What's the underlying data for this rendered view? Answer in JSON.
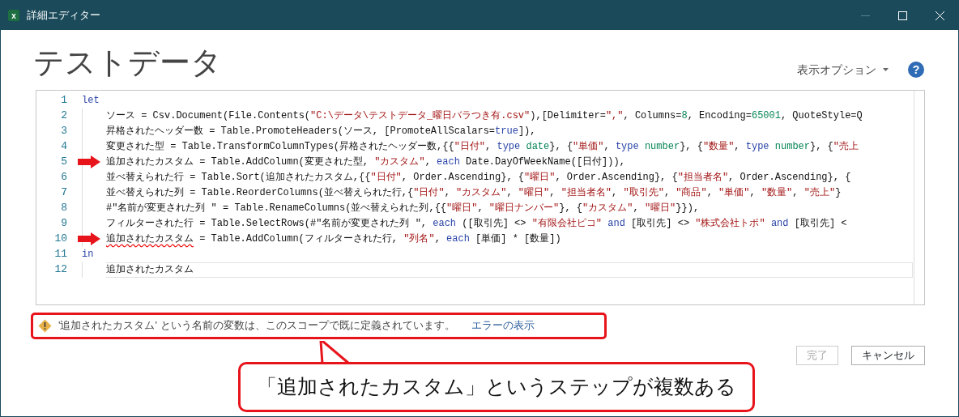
{
  "window": {
    "title": "詳細エディター",
    "app_icon": "x"
  },
  "help_icon": "?",
  "query_title": "テストデータ",
  "display_options": "表示オプション",
  "code": {
    "lines": [
      {
        "number": "1",
        "arrow": false,
        "current": false,
        "tokens": [
          {
            "kind": "keyword",
            "text": "let"
          }
        ],
        "children": [
          {
            "number": "2",
            "arrow": false,
            "current": false,
            "tokens": [
              {
                "kind": "text",
                "text": "ソース = Csv.Document(File.Contents("
              },
              {
                "kind": "string",
                "text": "\"C:\\データ\\テストデータ_曜日バラつき有.csv\""
              },
              {
                "kind": "text",
                "text": "),[Delimiter="
              },
              {
                "kind": "string",
                "text": "\",\""
              },
              {
                "kind": "text",
                "text": ", Columns="
              },
              {
                "kind": "number",
                "text": "8"
              },
              {
                "kind": "text",
                "text": ", Encoding="
              },
              {
                "kind": "number",
                "text": "65001"
              },
              {
                "kind": "text",
                "text": ", QuoteStyle=Q"
              }
            ]
          },
          {
            "number": "3",
            "arrow": false,
            "current": false,
            "tokens": [
              {
                "kind": "text",
                "text": "昇格されたヘッダー数 = Table.PromoteHeaders(ソース, [PromoteAllScalars="
              },
              {
                "kind": "keyword",
                "text": "true"
              },
              {
                "kind": "text",
                "text": "]),"
              }
            ]
          },
          {
            "number": "4",
            "arrow": false,
            "current": false,
            "tokens": [
              {
                "kind": "text",
                "text": "変更された型 = Table.TransformColumnTypes(昇格されたヘッダー数,{{"
              },
              {
                "kind": "string",
                "text": "\"日付\""
              },
              {
                "kind": "text",
                "text": ", "
              },
              {
                "kind": "keyword",
                "text": "type"
              },
              {
                "kind": "number",
                "text": " date"
              },
              {
                "kind": "text",
                "text": "}, {"
              },
              {
                "kind": "string",
                "text": "\"単価\""
              },
              {
                "kind": "text",
                "text": ", "
              },
              {
                "kind": "keyword",
                "text": "type"
              },
              {
                "kind": "number",
                "text": " number"
              },
              {
                "kind": "text",
                "text": "}, {"
              },
              {
                "kind": "string",
                "text": "\"数量\""
              },
              {
                "kind": "text",
                "text": ", "
              },
              {
                "kind": "keyword",
                "text": "type"
              },
              {
                "kind": "number",
                "text": " number"
              },
              {
                "kind": "text",
                "text": "}, {"
              },
              {
                "kind": "string",
                "text": "\"売上"
              }
            ]
          },
          {
            "number": "5",
            "arrow": true,
            "current": false,
            "tokens": [
              {
                "kind": "text",
                "text": "追加されたカスタム = Table.AddColumn(変更された型, "
              },
              {
                "kind": "string",
                "text": "\"カスタム\""
              },
              {
                "kind": "text",
                "text": ", "
              },
              {
                "kind": "keyword",
                "text": "each"
              },
              {
                "kind": "text",
                "text": " Date.DayOfWeekName([日付])),"
              }
            ]
          },
          {
            "number": "6",
            "arrow": false,
            "current": false,
            "tokens": [
              {
                "kind": "text",
                "text": "並べ替えられた行 = Table.Sort(追加されたカスタム,{{"
              },
              {
                "kind": "string",
                "text": "\"日付\""
              },
              {
                "kind": "text",
                "text": ", Order.Ascending}, {"
              },
              {
                "kind": "string",
                "text": "\"曜日\""
              },
              {
                "kind": "text",
                "text": ", Order.Ascending}, {"
              },
              {
                "kind": "string",
                "text": "\"担当者名\""
              },
              {
                "kind": "text",
                "text": ", Order.Ascending}, {"
              }
            ]
          },
          {
            "number": "7",
            "arrow": false,
            "current": false,
            "tokens": [
              {
                "kind": "text",
                "text": "並べ替えられた列 = Table.ReorderColumns(並べ替えられた行,{"
              },
              {
                "kind": "string",
                "text": "\"日付\""
              },
              {
                "kind": "text",
                "text": ", "
              },
              {
                "kind": "string",
                "text": "\"カスタム\""
              },
              {
                "kind": "text",
                "text": ", "
              },
              {
                "kind": "string",
                "text": "\"曜日\""
              },
              {
                "kind": "text",
                "text": ", "
              },
              {
                "kind": "string",
                "text": "\"担当者名\""
              },
              {
                "kind": "text",
                "text": ", "
              },
              {
                "kind": "string",
                "text": "\"取引先\""
              },
              {
                "kind": "text",
                "text": ", "
              },
              {
                "kind": "string",
                "text": "\"商品\""
              },
              {
                "kind": "text",
                "text": ", "
              },
              {
                "kind": "string",
                "text": "\"単価\""
              },
              {
                "kind": "text",
                "text": ", "
              },
              {
                "kind": "string",
                "text": "\"数量\""
              },
              {
                "kind": "text",
                "text": ", "
              },
              {
                "kind": "string",
                "text": "\"売上\""
              },
              {
                "kind": "text",
                "text": "}"
              }
            ]
          },
          {
            "number": "8",
            "arrow": false,
            "current": false,
            "tokens": [
              {
                "kind": "text",
                "text": "#\"名前が変更された列 \" = Table.RenameColumns(並べ替えられた列,{{"
              },
              {
                "kind": "string",
                "text": "\"曜日\""
              },
              {
                "kind": "text",
                "text": ", "
              },
              {
                "kind": "string",
                "text": "\"曜日ナンバー\""
              },
              {
                "kind": "text",
                "text": "}, {"
              },
              {
                "kind": "string",
                "text": "\"カスタム\""
              },
              {
                "kind": "text",
                "text": ", "
              },
              {
                "kind": "string",
                "text": "\"曜日\""
              },
              {
                "kind": "text",
                "text": "}}),"
              }
            ]
          },
          {
            "number": "9",
            "arrow": false,
            "current": false,
            "tokens": [
              {
                "kind": "text",
                "text": "フィルターされた行 = Table.SelectRows(#\"名前が変更された列 \", "
              },
              {
                "kind": "keyword",
                "text": "each"
              },
              {
                "kind": "text",
                "text": " ([取引先] <> "
              },
              {
                "kind": "string",
                "text": "\"有限会社ピコ\""
              },
              {
                "kind": "keyword",
                "text": " and"
              },
              {
                "kind": "text",
                "text": " [取引先] <> "
              },
              {
                "kind": "string",
                "text": "\"株式会社トポ\""
              },
              {
                "kind": "keyword",
                "text": " and"
              },
              {
                "kind": "text",
                "text": " [取引先] <"
              }
            ]
          },
          {
            "number": "10",
            "arrow": true,
            "current": false,
            "tokens": [
              {
                "kind": "error",
                "text": "追加されたカスタム"
              },
              {
                "kind": "text",
                "text": " = Table.AddColumn(フィルターされた行, "
              },
              {
                "kind": "string",
                "text": "\"列名\""
              },
              {
                "kind": "text",
                "text": ", "
              },
              {
                "kind": "keyword",
                "text": "each"
              },
              {
                "kind": "text",
                "text": " [単価] * [数量])"
              }
            ]
          }
        ]
      },
      {
        "number": "11",
        "arrow": false,
        "current": false,
        "tokens": [
          {
            "kind": "keyword",
            "text": "in"
          }
        ],
        "children": [
          {
            "number": "12",
            "arrow": false,
            "current": true,
            "tokens": [
              {
                "kind": "text",
                "text": "追加されたカスタム"
              }
            ]
          }
        ]
      }
    ]
  },
  "error": {
    "message": "'追加されたカスタム' という名前の変数は、このスコープで既に定義されています。",
    "link": "エラーの表示"
  },
  "buttons": [
    {
      "label": "完了",
      "disabled": true
    },
    {
      "label": "キャンセル",
      "disabled": false
    }
  ],
  "callout": "「追加されたカスタム」というステップが複数ある"
}
